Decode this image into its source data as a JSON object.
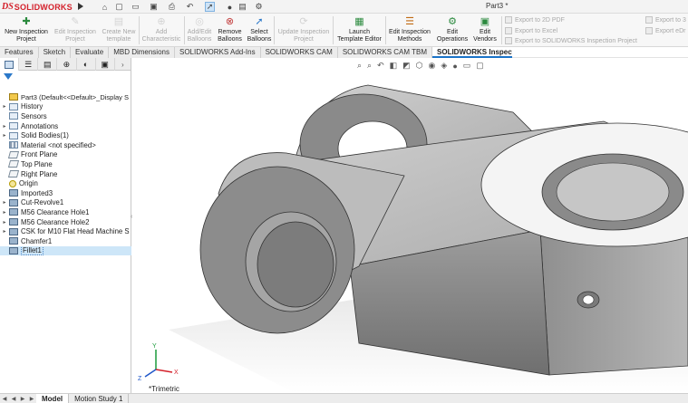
{
  "app": {
    "logo_ds": "DS",
    "logo_name": "SOLIDWORKS",
    "document_title": "Part3 *"
  },
  "quick_access": [
    "home-icon",
    "new-icon",
    "open-icon",
    "save-icon",
    "print-icon",
    "undo-icon",
    "select-icon",
    "rebuild-icon",
    "options-icon"
  ],
  "ribbon": {
    "buttons": [
      {
        "name": "new-inspection-project-button",
        "line1": "New Inspection",
        "line2": "Project",
        "enabled": true,
        "icon": "+"
      },
      {
        "name": "edit-inspection-project-button",
        "line1": "Edit Inspection",
        "line2": "Project",
        "enabled": false,
        "icon": "✎"
      },
      {
        "name": "create-new-template-button",
        "line1": "Create New",
        "line2": "template",
        "enabled": false,
        "icon": "▤"
      },
      {
        "name": "add-characteristic-button",
        "line1": "Add",
        "line2": "Characteristic",
        "enabled": false,
        "icon": "⊕"
      },
      {
        "name": "add-edit-balloons-button",
        "line1": "Add/Edit",
        "line2": "Balloons",
        "enabled": false,
        "icon": "◎"
      },
      {
        "name": "remove-balloons-button",
        "line1": "Remove",
        "line2": "Balloons",
        "enabled": true,
        "icon": "⊗"
      },
      {
        "name": "select-balloons-button",
        "line1": "Select",
        "line2": "Balloons",
        "enabled": true,
        "icon": "➚"
      },
      {
        "name": "update-inspection-project-button",
        "line1": "Update Inspection",
        "line2": "Project",
        "enabled": false,
        "icon": "⟳"
      },
      {
        "name": "launch-template-editor-button",
        "line1": "Launch",
        "line2": "Template Editor",
        "enabled": true,
        "icon": "▦"
      },
      {
        "name": "edit-inspection-methods-button",
        "line1": "Edit Inspection",
        "line2": "Methods",
        "enabled": true,
        "icon": "☰"
      },
      {
        "name": "edit-operations-button",
        "line1": "Edit",
        "line2": "Operations",
        "enabled": true,
        "icon": "⚙"
      },
      {
        "name": "edit-vendors-button",
        "line1": "Edit",
        "line2": "Vendors",
        "enabled": true,
        "icon": "▣"
      }
    ],
    "export": {
      "pdf": "Export to 2D PDF",
      "excel": "Export to Excel",
      "inspection_project": "Export to SOLIDWORKS Inspection Project",
      "right1": "Export to 3",
      "right2": "Export eDr"
    }
  },
  "tabs": [
    {
      "label": "Features",
      "active": false
    },
    {
      "label": "Sketch",
      "active": false
    },
    {
      "label": "Evaluate",
      "active": false
    },
    {
      "label": "MBD Dimensions",
      "active": false
    },
    {
      "label": "SOLIDWORKS Add-Ins",
      "active": false
    },
    {
      "label": "SOLIDWORKS CAM",
      "active": false
    },
    {
      "label": "SOLIDWORKS CAM TBM",
      "active": false
    },
    {
      "label": "SOLIDWORKS Inspection",
      "active": true
    }
  ],
  "feature_tree": {
    "root": "Part3  (Default<<Default>_Display S",
    "items": [
      {
        "label": "History",
        "expandable": true,
        "icon": "history-icon",
        "kind": "box"
      },
      {
        "label": "Sensors",
        "expandable": false,
        "icon": "sensor-icon",
        "kind": "box"
      },
      {
        "label": "Annotations",
        "expandable": true,
        "icon": "annotations-icon",
        "kind": "box"
      },
      {
        "label": "Solid Bodies(1)",
        "expandable": true,
        "icon": "solid-bodies-icon",
        "kind": "box"
      },
      {
        "label": "Material <not specified>",
        "expandable": false,
        "icon": "material-icon",
        "kind": "mat"
      },
      {
        "label": "Front Plane",
        "expandable": false,
        "icon": "plane-icon",
        "kind": "plane"
      },
      {
        "label": "Top Plane",
        "expandable": false,
        "icon": "plane-icon",
        "kind": "plane"
      },
      {
        "label": "Right Plane",
        "expandable": false,
        "icon": "plane-icon",
        "kind": "plane"
      },
      {
        "label": "Origin",
        "expandable": false,
        "icon": "origin-icon",
        "kind": "orig"
      },
      {
        "label": "Imported3",
        "expandable": false,
        "icon": "imported-body-icon",
        "kind": "feat"
      },
      {
        "label": "Cut-Revolve1",
        "expandable": true,
        "icon": "cut-revolve-icon",
        "kind": "feat"
      },
      {
        "label": "M56 Clearance Hole1",
        "expandable": true,
        "icon": "hole-icon",
        "kind": "feat"
      },
      {
        "label": "M56 Clearance Hole2",
        "expandable": true,
        "icon": "hole-icon",
        "kind": "feat"
      },
      {
        "label": "CSK for M10 Flat Head Machine S",
        "expandable": true,
        "icon": "hole-icon",
        "kind": "feat"
      },
      {
        "label": "Chamfer1",
        "expandable": false,
        "icon": "chamfer-icon",
        "kind": "feat"
      },
      {
        "label": "Fillet1",
        "expandable": false,
        "icon": "fillet-icon",
        "kind": "feat",
        "selected": true
      }
    ]
  },
  "viewport": {
    "view_label": "*Trimetric",
    "triad": {
      "x": "X",
      "y": "Y",
      "z": "Z"
    }
  },
  "bottom_tabs": [
    {
      "label": "Model",
      "active": true
    },
    {
      "label": "Motion Study 1",
      "active": false
    }
  ]
}
